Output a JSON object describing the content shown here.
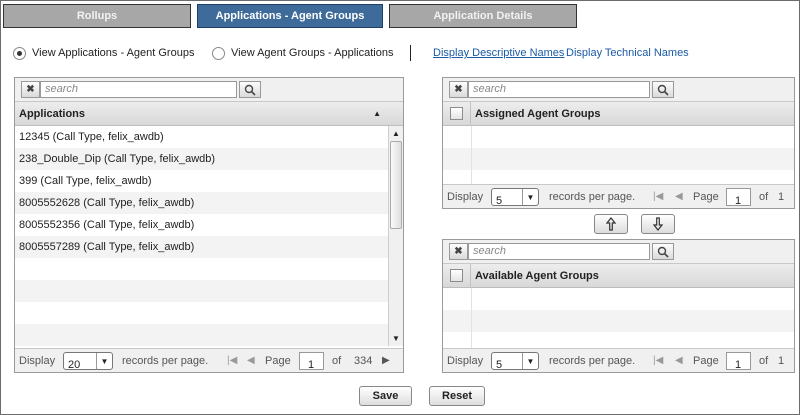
{
  "tabs": [
    {
      "label": "Rollups"
    },
    {
      "label": "Applications - Agent Groups"
    },
    {
      "label": "Application Details"
    }
  ],
  "view_options": {
    "option1": "View Applications - Agent Groups",
    "option2": "View Agent Groups - Applications",
    "link_descriptive": "Display Descriptive Names",
    "link_technical": "Display Technical Names"
  },
  "applications_panel": {
    "search_placeholder": "search",
    "header": "Applications",
    "rows": [
      "12345 (Call Type,  felix_awdb)",
      "238_Double_Dip (Call Type,  felix_awdb)",
      "399 (Call Type,  felix_awdb)",
      "8005552628 (Call Type,  felix_awdb)",
      "8005552356 (Call Type,  felix_awdb)",
      "8005557289 (Call Type,  felix_awdb)"
    ],
    "pager": {
      "display": "Display",
      "per_page_value": "20",
      "records_label": "records per page.",
      "page_label": "Page",
      "page_value": "1",
      "of_label": "of",
      "total_pages": "334"
    }
  },
  "assigned_panel": {
    "search_placeholder": "search",
    "header": "Assigned Agent Groups",
    "pager": {
      "display": "Display",
      "per_page_value": "5",
      "records_label": "records per page.",
      "page_label": "Page",
      "page_value": "1",
      "of_label": "of",
      "total_pages": "1"
    }
  },
  "available_panel": {
    "search_placeholder": "search",
    "header": "Available Agent Groups",
    "pager": {
      "display": "Display",
      "per_page_value": "5",
      "records_label": "records per page.",
      "page_label": "Page",
      "page_value": "1",
      "of_label": "of",
      "total_pages": "1"
    }
  },
  "buttons": {
    "save": "Save",
    "reset": "Reset"
  },
  "colors": {
    "active_tab": "#3f6b9a",
    "inactive_tab": "#a7a7a7",
    "link": "#1a5aa6"
  }
}
